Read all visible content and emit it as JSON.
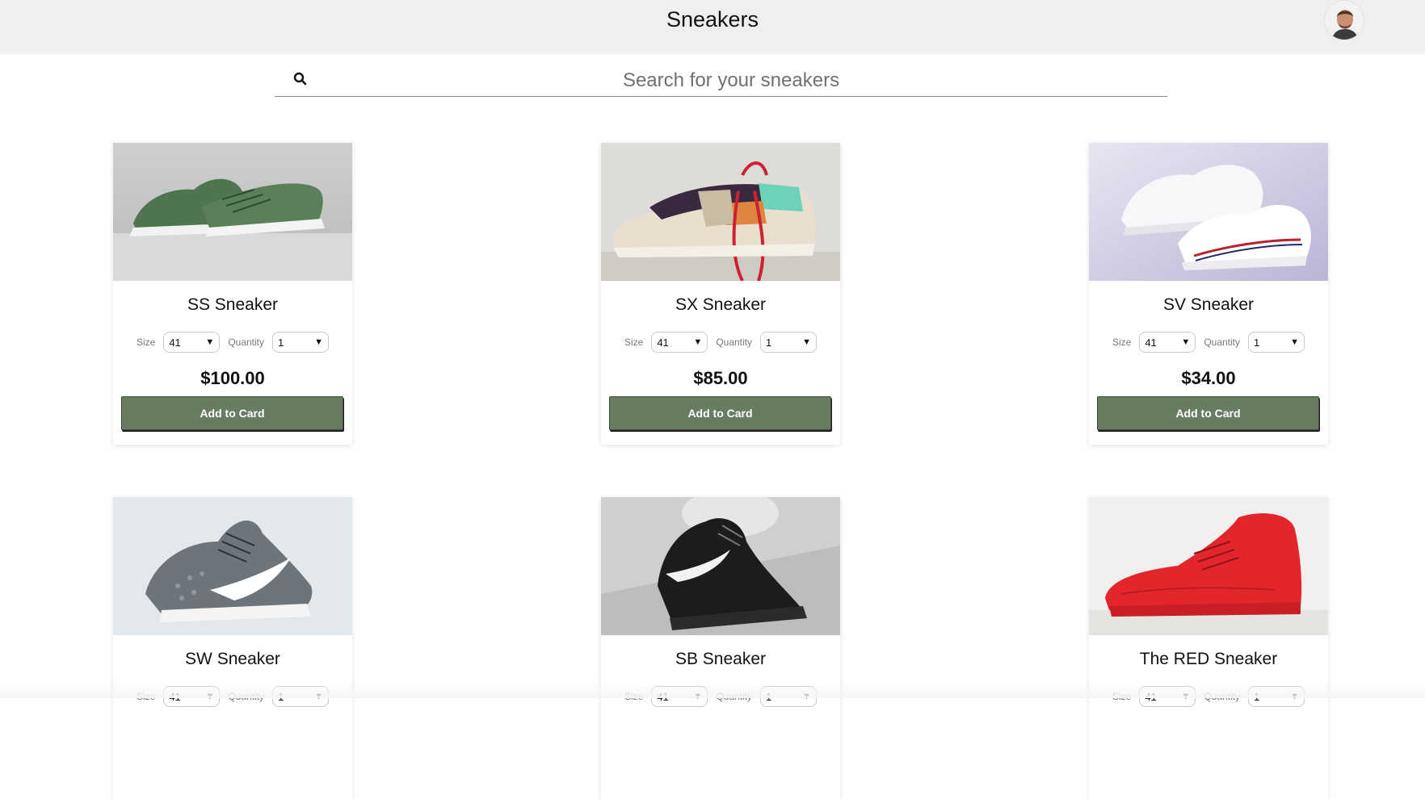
{
  "header": {
    "title": "Sneakers"
  },
  "search": {
    "placeholder": "Search for your sneakers",
    "icon": "search-icon"
  },
  "labels": {
    "size": "Size",
    "quantity": "Quantity"
  },
  "colors": {
    "button_bg": "#667d62",
    "header_bg": "#efefef"
  },
  "products": [
    {
      "name": "SS Sneaker",
      "size": "41",
      "quantity": "1",
      "price": "$100.00",
      "button": "Add to Card"
    },
    {
      "name": "SX Sneaker",
      "size": "41",
      "quantity": "1",
      "price": "$85.00",
      "button": "Add to Card"
    },
    {
      "name": "SV Sneaker",
      "size": "41",
      "quantity": "1",
      "price": "$34.00",
      "button": "Add to Card"
    },
    {
      "name": "SW Sneaker",
      "size": "41",
      "quantity": "1",
      "price": "",
      "button": ""
    },
    {
      "name": "SB Sneaker",
      "size": "41",
      "quantity": "1",
      "price": "",
      "button": ""
    },
    {
      "name": "The RED Sneaker",
      "size": "41",
      "quantity": "1",
      "price": "",
      "button": ""
    }
  ]
}
